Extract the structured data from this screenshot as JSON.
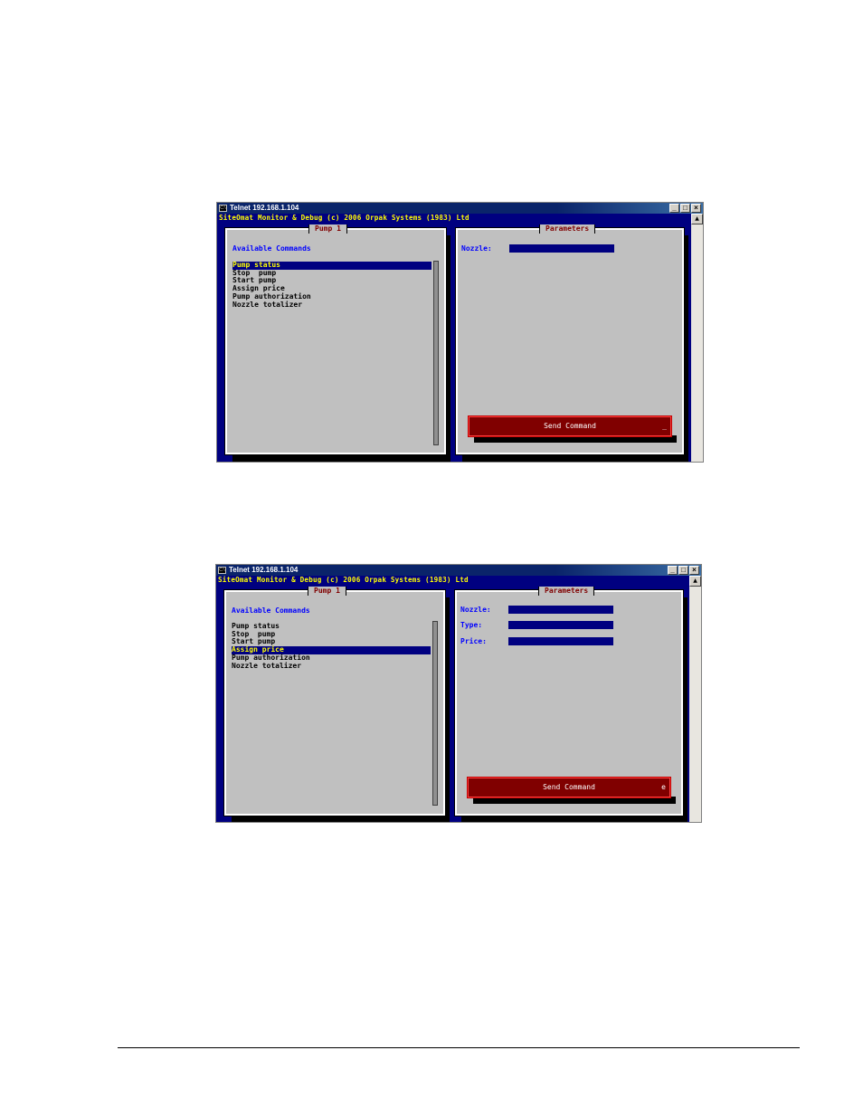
{
  "screenshots": [
    {
      "window_title": "Telnet 192.168.1.104",
      "banner": "SiteOmat Monitor & Debug (c) 2006 Orpak Systems (1983) Ltd",
      "left_panel_title": "Pump 1",
      "right_panel_title": "Parameters",
      "available_commands_label": "Available Commands",
      "commands": [
        "Pump status",
        "Stop  pump",
        "Start pump",
        "Assign price",
        "Pump authorization",
        "Nozzle totalizer"
      ],
      "selected_command": "Pump status",
      "parameters": [
        {
          "label": "Nozzle:"
        }
      ],
      "send_button": "Send Command",
      "button_mark": "_"
    },
    {
      "window_title": "Telnet 192.168.1.104",
      "banner": "SiteOmat Monitor & Debug (c) 2006 Orpak Systems (1983) Ltd",
      "left_panel_title": "Pump 1",
      "right_panel_title": "Parameters",
      "available_commands_label": "Available Commands",
      "commands": [
        "Pump status",
        "Stop  pump",
        "Start pump",
        "Assign price",
        "Pump authorization",
        "Nozzle totalizer"
      ],
      "selected_command": "Assign price",
      "parameters": [
        {
          "label": "Nozzle:"
        },
        {
          "label": "Type:"
        },
        {
          "label": "Price:"
        }
      ],
      "send_button": "Send Command",
      "button_mark": "e"
    }
  ]
}
